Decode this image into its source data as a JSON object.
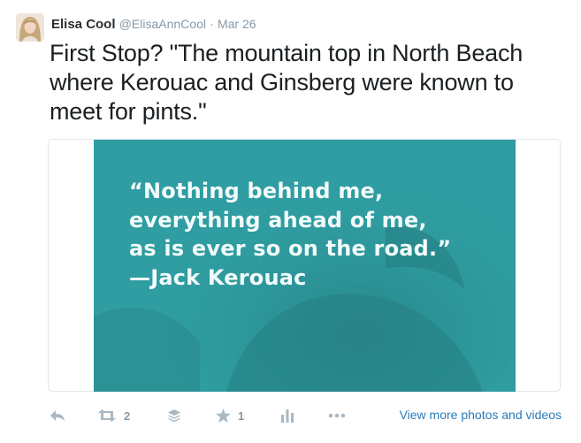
{
  "author": {
    "fullname": "Elisa Cool",
    "username": "@ElisaAnnCool",
    "separator": "·",
    "date": "Mar 26"
  },
  "tweet": {
    "text": "First Stop?  \"The mountain top in North Beach where Kerouac and Ginsberg were known to meet for pints.\""
  },
  "media": {
    "quote_lines": [
      "“Nothing behind me,",
      "everything ahead of me,",
      "as is ever so on the road.”",
      "—Jack Kerouac"
    ]
  },
  "actions": {
    "reply_icon": "reply-icon",
    "retweet_icon": "retweet-icon",
    "retweet_count": "2",
    "buffer_icon": "buffer-icon",
    "favorite_icon": "star-icon",
    "favorite_count": "1",
    "analytics_icon": "analytics-icon",
    "more_icon": "more-icon",
    "view_more_label": "View more photos and videos"
  },
  "colors": {
    "media_bg": "#2f9da1",
    "link": "#2b7bb9",
    "icon": "#aab8c2"
  }
}
